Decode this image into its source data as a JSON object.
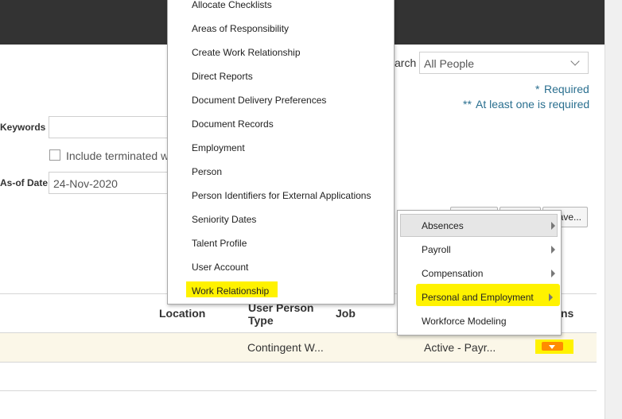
{
  "search": {
    "label_fragment": "arch",
    "people_value": "All People",
    "required_note": "Required",
    "required_star": "*",
    "at_least_one_note": "At least one is required",
    "at_least_one_stars": "**"
  },
  "form": {
    "keywords_label": "Keywords",
    "keywords_value": "",
    "include_terminated_label": "Include terminated w",
    "asof_label": "As-of Date",
    "asof_value": "24-Nov-2020",
    "save_button_fragment": "ave..."
  },
  "table": {
    "headers": {
      "location": "Location",
      "user_person_type_line1": "User Person",
      "user_person_type_line2": "Type",
      "job": "Job",
      "actions_fragment": "ns"
    },
    "row": {
      "user_person_type": "Contingent W...",
      "assignment_status": "Active - Payr..."
    }
  },
  "menu_primary": {
    "items": [
      "Allocate Checklists",
      "Areas of Responsibility",
      "Create Work Relationship",
      "Direct Reports",
      "Document Delivery Preferences",
      "Document Records",
      "Employment",
      "Person",
      "Person Identifiers for External Applications",
      "Seniority Dates",
      "Talent Profile",
      "User Account",
      "Work Relationship"
    ]
  },
  "menu_secondary": {
    "items": [
      "Absences",
      "Payroll",
      "Compensation",
      "Personal and Employment",
      "Workforce Modeling"
    ]
  },
  "colors": {
    "highlight": "#fff200",
    "actions_button": "#ff8c00",
    "required_text": "#2a6f8f",
    "topbar": "#333333",
    "row_highlight": "#fbf7e8"
  }
}
